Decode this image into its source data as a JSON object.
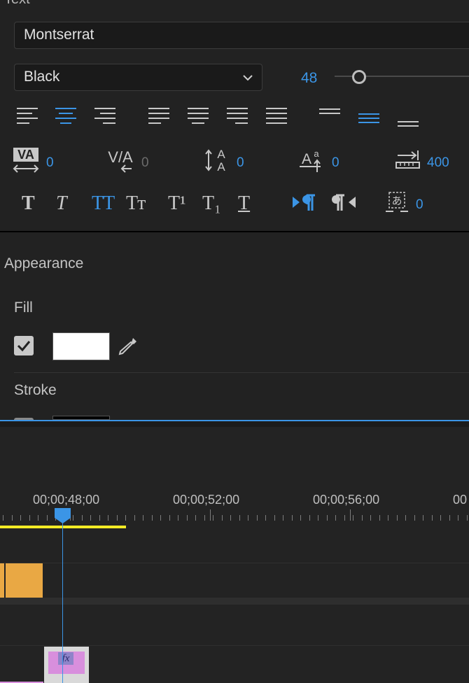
{
  "text_section": {
    "header": "Text"
  },
  "font": {
    "family": "Montserrat",
    "style": "Black",
    "size": "48",
    "size_slider_fraction": 0.18
  },
  "align_icons": [
    "align-left-icon",
    "align-center-icon",
    "align-right-icon",
    "justify-last-left-icon",
    "justify-last-center-icon",
    "justify-last-right-icon",
    "justify-all-icon",
    "align-top-icon",
    "align-middle-icon",
    "align-bottom-icon"
  ],
  "metrics": {
    "kerning": "0",
    "tracking": "0",
    "leading": "0",
    "baseline_shift": "0",
    "tab_width": "400"
  },
  "style_buttons": {
    "faux_bold": "T",
    "faux_italic": "T",
    "all_caps": "TT",
    "small_caps": "Tт",
    "superscript": "T¹",
    "subscript": "T₁",
    "underline": "T"
  },
  "tsume": "0",
  "appearance": {
    "header": "Appearance",
    "fill_label": "Fill",
    "fill_enabled": true,
    "fill_color": "#FFFFFF",
    "stroke_label": "Stroke",
    "stroke_color": "#000000"
  },
  "timeline": {
    "timecodes": [
      "00;00;48;00",
      "00;00;52;00",
      "00;00;56;00",
      "00"
    ],
    "playhead_color": "#3b95e6",
    "work_area_color": "#f2ea25",
    "clip_color": "#e9a844",
    "graphic_clip_color": "#d88fdd",
    "fx_label": "fx"
  },
  "colors": {
    "accent": "#3b95e6",
    "panel_bg": "#222222",
    "text": "#d0d0d0"
  }
}
